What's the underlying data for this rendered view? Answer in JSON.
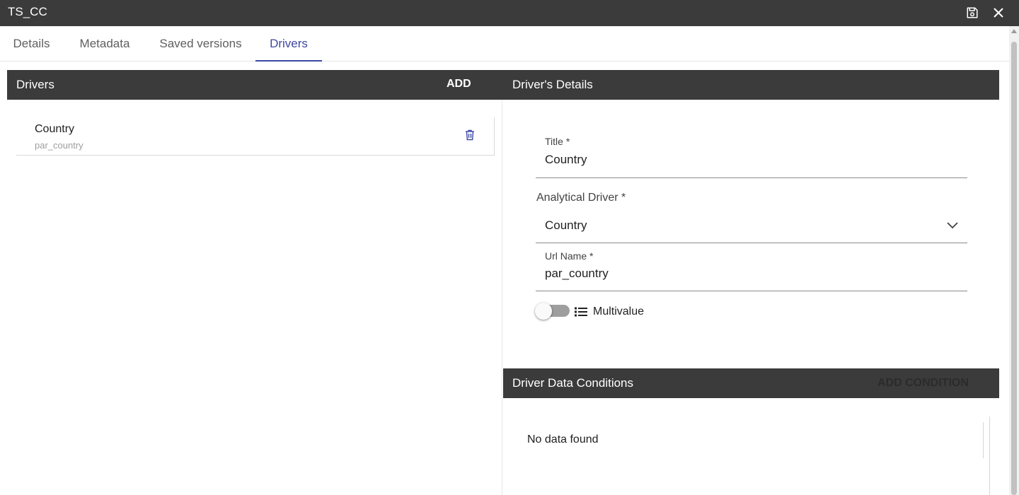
{
  "window": {
    "title": "TS_CC",
    "actions": [
      {
        "name": "save-icon"
      },
      {
        "name": "close-icon"
      }
    ]
  },
  "tabs": [
    {
      "label": "Details",
      "active": false
    },
    {
      "label": "Metadata",
      "active": false
    },
    {
      "label": "Saved versions",
      "active": false
    },
    {
      "label": "Drivers",
      "active": true
    }
  ],
  "colors": {
    "header_bg": "#3b3b3b",
    "accent": "#3c48a3",
    "muted_text": "#9e9e9e"
  },
  "drivers_panel": {
    "title": "Drivers",
    "add_label": "ADD",
    "items": [
      {
        "title": "Country",
        "url_name": "par_country",
        "delete_icon": "trash-icon"
      }
    ]
  },
  "details_panel": {
    "title": "Driver's Details",
    "title_field": {
      "label": "Title *",
      "value": "Country"
    },
    "analytical_driver": {
      "label": "Analytical Driver *",
      "value": "Country",
      "icon": "chevron-down-icon"
    },
    "url_name_field": {
      "label": "Url Name *",
      "value": "par_country"
    },
    "multivalue": {
      "label": "Multivalue",
      "enabled": false,
      "icon": "list-icon"
    }
  },
  "conditions_panel": {
    "title": "Driver Data Conditions",
    "add_label": "ADD CONDITION",
    "empty_message": "No data found"
  }
}
